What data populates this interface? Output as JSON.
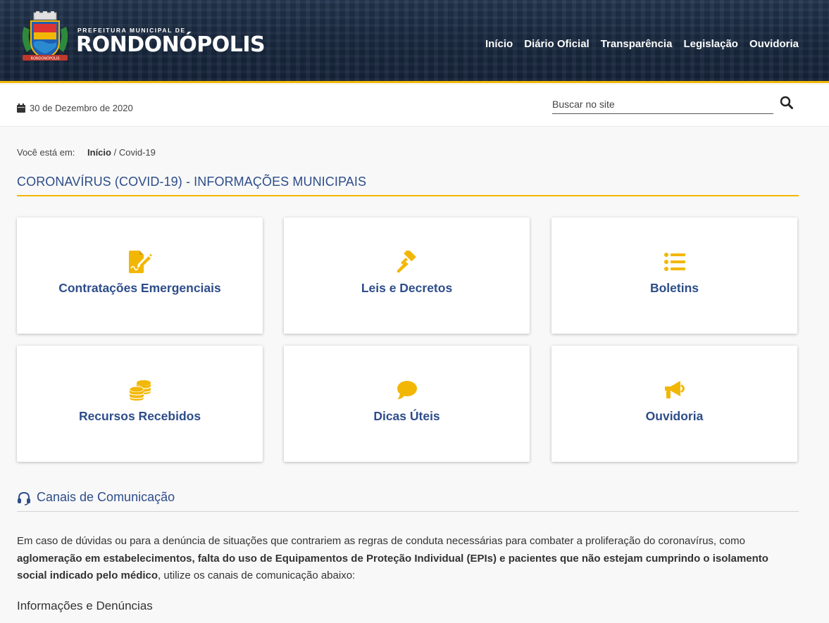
{
  "header": {
    "logo_small": "PREFEITURA MUNICIPAL DE",
    "logo_big": "RONDONÓPOLIS",
    "nav": [
      {
        "label": "Início"
      },
      {
        "label": "Diário Oficial"
      },
      {
        "label": "Transparência"
      },
      {
        "label": "Legislação"
      },
      {
        "label": "Ouvidoria"
      }
    ]
  },
  "topbar": {
    "date": "30 de Dezembro de 2020",
    "search_placeholder": "Buscar no site"
  },
  "breadcrumb": {
    "prefix": "Você está em:",
    "home": "Início",
    "separator": "/",
    "current": "Covid-19"
  },
  "page_title": "CORONAVÍRUS (COVID-19) - INFORMAÇÕES MUNICIPAIS",
  "cards": [
    {
      "label": "Contratações Emergenciais",
      "icon": "file-signature-icon"
    },
    {
      "label": "Leis e Decretos",
      "icon": "gavel-icon"
    },
    {
      "label": "Boletins",
      "icon": "list-icon"
    },
    {
      "label": "Recursos Recebidos",
      "icon": "coins-icon"
    },
    {
      "label": "Dicas Úteis",
      "icon": "comment-icon"
    },
    {
      "label": "Ouvidoria",
      "icon": "bullhorn-icon"
    }
  ],
  "section": {
    "title": "Canais de Comunicação",
    "paragraph_part1": "Em caso de dúvidas ou para a denúncia de situações que contrariem as regras de conduta necessárias para combater a proliferação do coronavírus, como ",
    "paragraph_bold": "aglomeração em estabelecimentos, falta do uso de Equipamentos de Proteção Individual (EPIs) e pacientes que não estejam cumprindo o isolamento social indicado pelo médico",
    "paragraph_part2": ", utilize os canais de comunicação abaixo:",
    "subheading": "Informações e Denúncias"
  },
  "colors": {
    "accent": "#f2b705",
    "primary": "#2d4d8a",
    "header_bg": "#1a2a40"
  }
}
